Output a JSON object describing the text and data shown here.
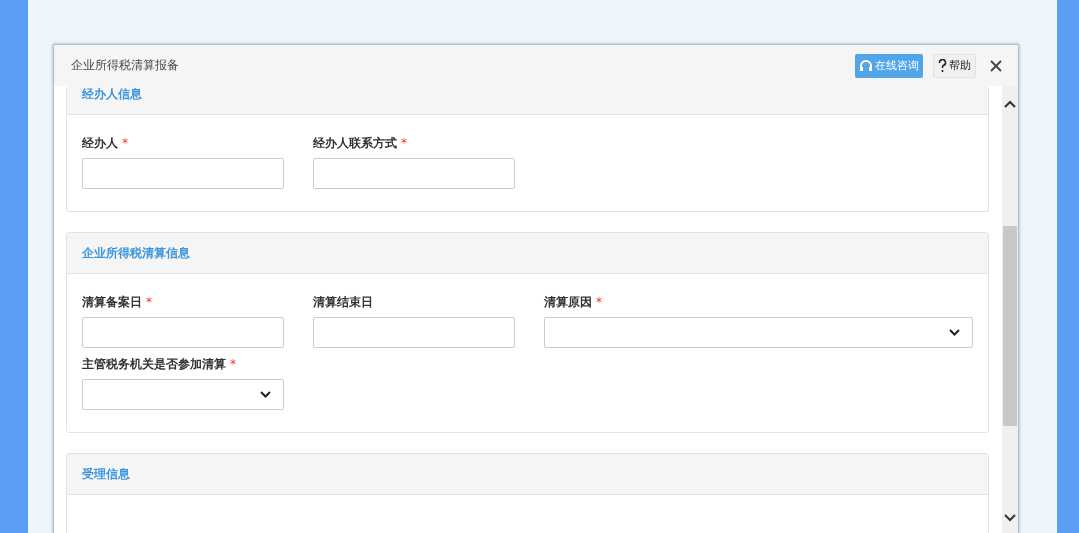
{
  "dialog": {
    "title": "企业所得税清算报备",
    "buttons": [
      {
        "kind": "consult",
        "label": "在线咨询"
      },
      {
        "kind": "help",
        "label": "帮助"
      }
    ]
  },
  "sections": [
    {
      "title": "经办人信息",
      "rows": [
        [
          {
            "label": "经办人",
            "required_mark": "*",
            "kind": "text"
          },
          {
            "label": "经办人联系方式",
            "required_mark": "*",
            "kind": "text"
          }
        ]
      ]
    },
    {
      "title": "企业所得税清算信息",
      "rows": [
        [
          {
            "label": "清算备案日",
            "required_mark": "*",
            "kind": "text"
          },
          {
            "label": "清算结束日",
            "kind": "text"
          },
          {
            "label": "清算原因",
            "required_mark": "*",
            "kind": "select"
          }
        ],
        [
          {
            "label": "主管税务机关是否参加清算",
            "required_mark": "*",
            "kind": "select"
          }
        ]
      ]
    },
    {
      "title": "受理信息"
    }
  ]
}
